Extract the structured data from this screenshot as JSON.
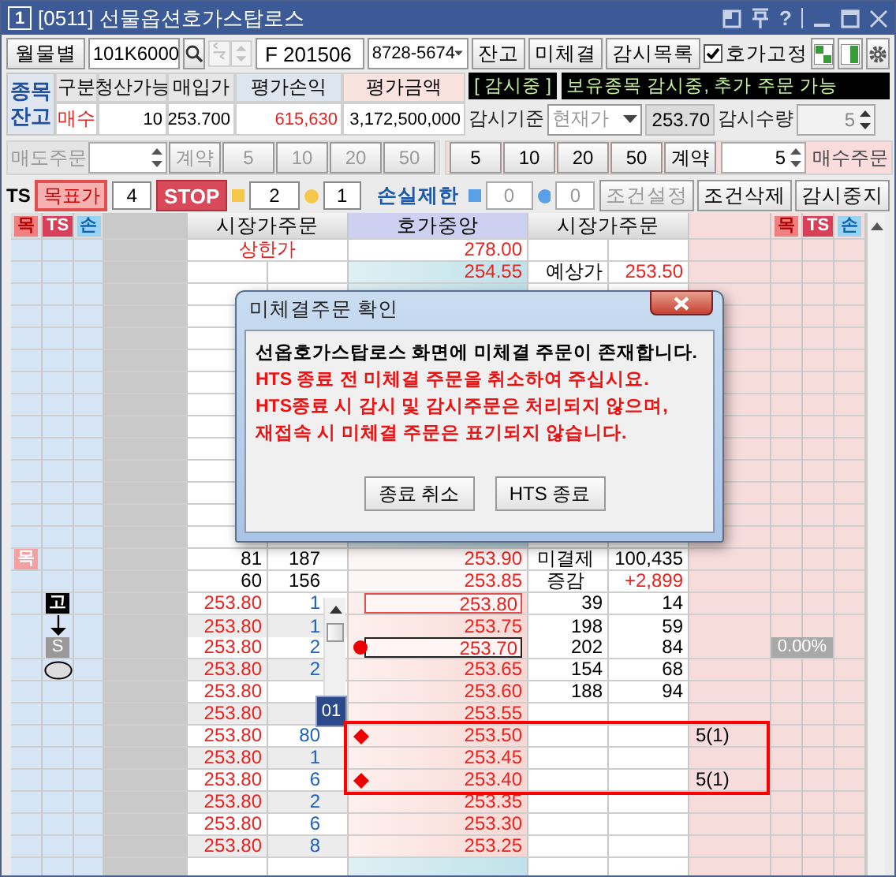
{
  "window": {
    "number": "1",
    "title": "[0511] 선물옵션호가스탑로스",
    "help": "?"
  },
  "toolbar": {
    "group_button": "월물별",
    "code": "101K6000",
    "name": "F 201506",
    "account": "8728-5674",
    "buttons": [
      "잔고",
      "미체결",
      "감시목록"
    ],
    "fix_price": {
      "label": "호가고정",
      "checked": true
    }
  },
  "balance": {
    "label_lines": [
      "종목",
      "잔고"
    ],
    "columns": [
      "구분",
      "청산가능",
      "매입가",
      "평가손익",
      "평가금액"
    ],
    "values": [
      {
        "text": "매수",
        "up": true
      },
      {
        "text": "10",
        "up": false
      },
      {
        "text": "253.700",
        "up": false
      },
      {
        "text": "615,630",
        "up": true
      },
      {
        "text": "3,172,500,000",
        "up": false
      }
    ]
  },
  "status": {
    "tag": "[ 감시중 ]",
    "message": "보유종목 감시중, 추가 주문 가능"
  },
  "watch": {
    "basis_label": "감시기준",
    "basis": "현재가",
    "price": "253.70",
    "qty_label": "감시수량",
    "qty": "5"
  },
  "sell_order": {
    "label": "매도주문",
    "disabled": true,
    "buttons": [
      "계약",
      "5",
      "10",
      "20",
      "50"
    ]
  },
  "buy_order": {
    "label": "매수주문",
    "buttons": [
      "5",
      "10",
      "20",
      "50",
      "계약"
    ],
    "qty": "5"
  },
  "ts_bar": {
    "label": "TS",
    "target": "목표가",
    "target_qty": "4",
    "stop": "STOP",
    "stop_qty": "2",
    "stop_qty_2": "1",
    "loss_limit": "손실제한",
    "loss_qty": "0",
    "loss_qty_2": "0",
    "buttons": [
      {
        "label": "조건설정",
        "disabled": true
      },
      {
        "label": "조건삭제",
        "disabled": false
      },
      {
        "label": "감시중지",
        "disabled": false
      }
    ]
  },
  "grid": {
    "tags": [
      {
        "kind": "target",
        "text": "목"
      },
      {
        "kind": "ts",
        "text": "TS"
      },
      {
        "kind": "loss",
        "text": "손"
      }
    ],
    "columns": [
      "시장가주문",
      "호가중앙",
      "시장가주문"
    ],
    "right_tags": [
      {
        "kind": "target",
        "text": "목"
      },
      {
        "kind": "ts",
        "text": "TS"
      },
      {
        "kind": "loss",
        "text": "손"
      }
    ],
    "rows": [
      {
        "kind": "limit",
        "label": "상한가",
        "price": "278.00"
      },
      {
        "kind": "ask",
        "price": "254.55",
        "right_1": "예상가",
        "right_2": "253.50",
        "right_2_up": true
      },
      {
        "kind": "quote",
        "left_1": "81",
        "left_2": "187",
        "price": "253.90",
        "right_1": "미결제",
        "right_2": "100,435",
        "right_2_up": false,
        "tag": {
          "kind": "target",
          "text": "목"
        }
      },
      {
        "kind": "quote",
        "left_1": "60",
        "left_2": "156",
        "price": "253.85",
        "right_1": "증감",
        "right_2": "+2,899",
        "right_2_up": true
      },
      {
        "kind": "stop",
        "left_1": "253.80",
        "left_2": "1",
        "price": "253.80",
        "frame": {
          "color": "#e05050"
        },
        "right_1": "39",
        "right_2": "14",
        "ts_mark": {
          "kind": "high",
          "text": "고"
        }
      },
      {
        "kind": "stop",
        "left_1": "253.80",
        "left_2": "1",
        "price": "253.75",
        "right_1": "198",
        "right_2": "59",
        "ts_mark": {
          "kind": "arrow"
        }
      },
      {
        "kind": "stop",
        "left_1": "253.80",
        "left_2": "2",
        "price": "253.70",
        "frame": {
          "color": "#222222"
        },
        "order_mark": {
          "kind": "dot"
        },
        "right_1": "202",
        "right_2": "84",
        "ts_mark": {
          "kind": "stop",
          "text": "S"
        },
        "right_tag": "0.00%"
      },
      {
        "kind": "stop",
        "left_1": "253.80",
        "left_2": "2",
        "price": "253.65",
        "right_1": "154",
        "right_2": "68",
        "ts_mark": {
          "kind": "oval"
        }
      },
      {
        "kind": "stop",
        "left_1": "253.80",
        "price": "253.60",
        "right_1": "188",
        "right_2": "94"
      },
      {
        "kind": "stop",
        "left_1": "253.80",
        "price": "253.55"
      },
      {
        "kind": "stop",
        "left_1": "253.80",
        "left_2": "80",
        "price": "253.50",
        "order_mark": {
          "kind": "diamond"
        },
        "note": "5(1)",
        "highlighted": true
      },
      {
        "kind": "stop",
        "left_1": "253.80",
        "left_2": "1",
        "price": "253.45",
        "highlighted": true
      },
      {
        "kind": "stop",
        "left_1": "253.80",
        "left_2": "6",
        "price": "253.40",
        "order_mark": {
          "kind": "diamond"
        },
        "note": "5(1)",
        "highlighted": true
      },
      {
        "kind": "stop",
        "left_1": "253.80",
        "left_2": "2",
        "price": "253.35"
      },
      {
        "kind": "stop",
        "left_1": "253.80",
        "left_2": "6",
        "price": "253.30"
      },
      {
        "kind": "stop",
        "left_1": "253.80",
        "left_2": "8",
        "price": "253.25"
      }
    ],
    "page_badge": "01"
  },
  "dialog": {
    "title": "미체결주문 확인",
    "lines": [
      {
        "kind": "info",
        "text": "선옵호가스탑로스 화면에 미체결 주문이 존재합니다."
      },
      {
        "kind": "warn",
        "text": "HTS 종료 전 미체결 주문을 취소하여 주십시요."
      },
      {
        "kind": "warn",
        "text": "HTS종료 시 감시 및 감시주문은 처리되지 않으며,"
      },
      {
        "kind": "warn",
        "text": "재접속 시 미체결 주문은 표기되지 않습니다."
      }
    ],
    "buttons": [
      "종료 취소",
      "HTS 종료"
    ]
  }
}
